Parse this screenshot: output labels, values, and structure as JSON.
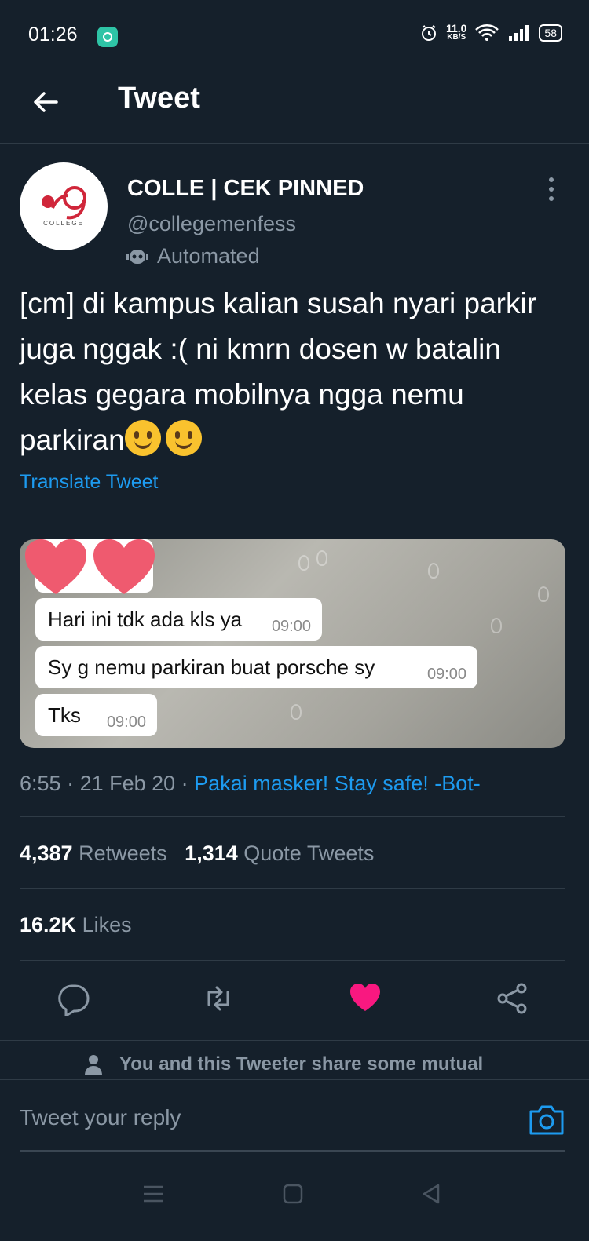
{
  "status_bar": {
    "time": "01:26",
    "speed_value": "11.0",
    "speed_unit": "KB/S",
    "battery": "58"
  },
  "header": {
    "title": "Tweet"
  },
  "tweet": {
    "display_name": "COLLE | CEK PINNED",
    "handle": "@collegemenfess",
    "badge": "Automated",
    "text": "[cm] di kampus kalian susah nyari parkir juga nggak :( ni kmrn dosen w batalin kelas gegara mobilnya ngga nemu parkiran",
    "emojis": [
      "slightly-smiling-face",
      "slightly-smiling-face"
    ],
    "translate_label": "Translate Tweet",
    "avatar_label": "COLLEGE",
    "media": {
      "messages": [
        {
          "text": "Hari ini tdk ada kls ya",
          "time": "09:00"
        },
        {
          "text": "Sy g nemu parkiran buat porsche sy",
          "time": "09:00"
        },
        {
          "text": "Tks",
          "time": "09:00"
        }
      ]
    },
    "time": "6:55",
    "date": "21 Feb 20",
    "source": "Pakai masker! Stay safe! -Bot-",
    "retweets_count": "4,387",
    "retweets_label": "Retweets",
    "quotes_count": "1,314",
    "quotes_label": "Quote Tweets",
    "likes_count": "16.2K",
    "likes_label": "Likes",
    "liked_color": "#f91880"
  },
  "mutual_text": "You and this Tweeter share some mutual",
  "reply": {
    "placeholder": "Tweet your reply"
  },
  "colors": {
    "background": "#15202b",
    "link": "#1d9bf0",
    "muted": "#8b98a5"
  }
}
